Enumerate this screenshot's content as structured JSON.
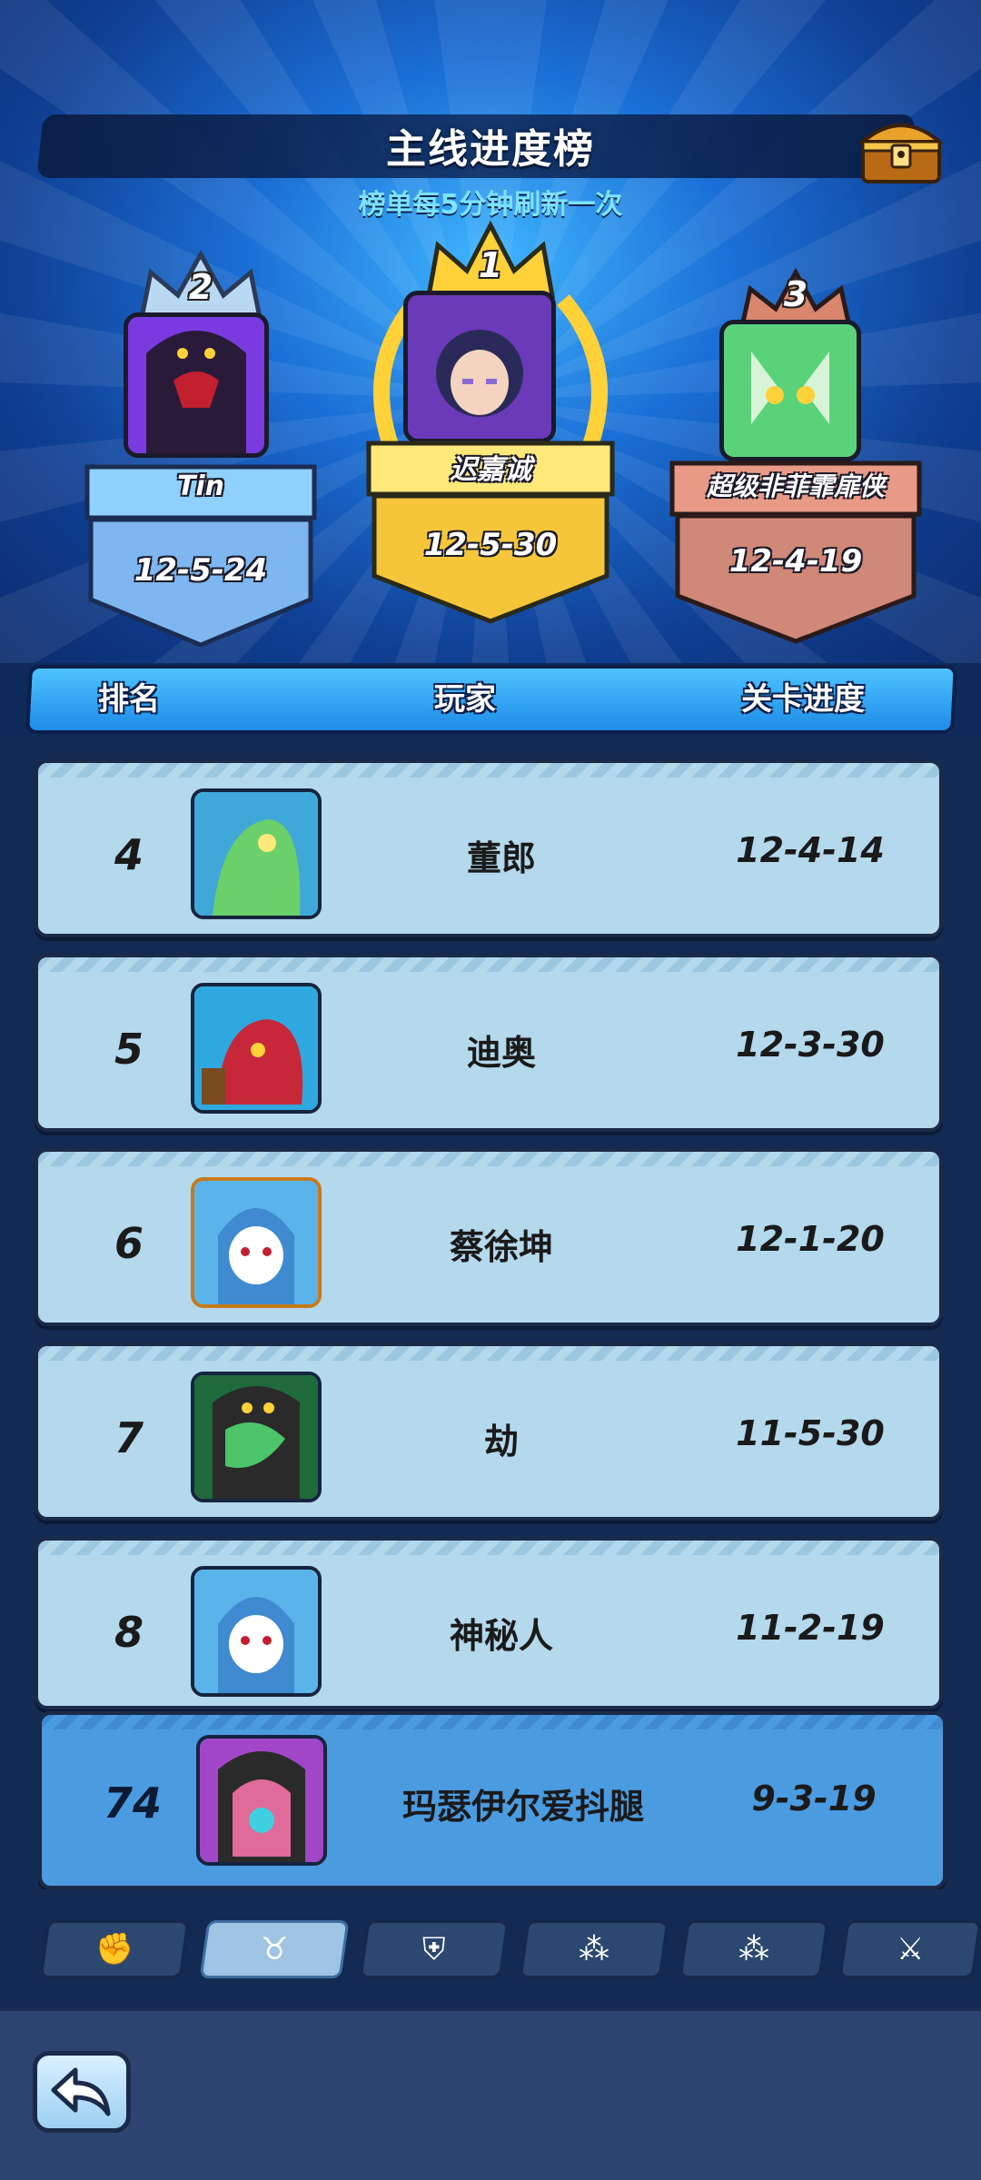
{
  "header": {
    "title": "主线进度榜",
    "subtitle": "榜单每5分钟刷新一次",
    "chest_icon": "treasure-chest-icon"
  },
  "podium": [
    {
      "rank": "2",
      "name": "Tin",
      "progress": "12-5-24",
      "color": "#7ec4ff"
    },
    {
      "rank": "1",
      "name": "迟嘉诚",
      "progress": "12-5-30",
      "color": "#ffd23a"
    },
    {
      "rank": "3",
      "name": "超级非菲霏扉侠",
      "progress": "12-4-19",
      "color": "#d98a78"
    }
  ],
  "table": {
    "columns": [
      "排名",
      "玩家",
      "关卡进度"
    ],
    "rows": [
      {
        "rank": "4",
        "name": "董郎",
        "progress": "12-4-14"
      },
      {
        "rank": "5",
        "name": "迪奥",
        "progress": "12-3-30"
      },
      {
        "rank": "6",
        "name": "蔡徐坤",
        "progress": "12-1-20"
      },
      {
        "rank": "7",
        "name": "劫",
        "progress": "11-5-30"
      },
      {
        "rank": "8",
        "name": "神秘人",
        "progress": "11-2-19"
      }
    ],
    "self": {
      "rank": "74",
      "name": "玛瑟伊尔爱抖腿",
      "progress": "9-3-19"
    }
  },
  "tabs": [
    {
      "icon": "fist-icon",
      "glyph": "✊",
      "active": false
    },
    {
      "icon": "bull-icon",
      "glyph": "♉",
      "active": true
    },
    {
      "icon": "shield-icon",
      "glyph": "⛨",
      "active": false
    },
    {
      "icon": "network-icon",
      "glyph": "⁂",
      "active": false
    },
    {
      "icon": "network-icon",
      "glyph": "⁂",
      "active": false
    },
    {
      "icon": "sword-icon",
      "glyph": "⚔",
      "active": false
    }
  ],
  "footer": {
    "back_icon": "back-arrow-icon"
  }
}
